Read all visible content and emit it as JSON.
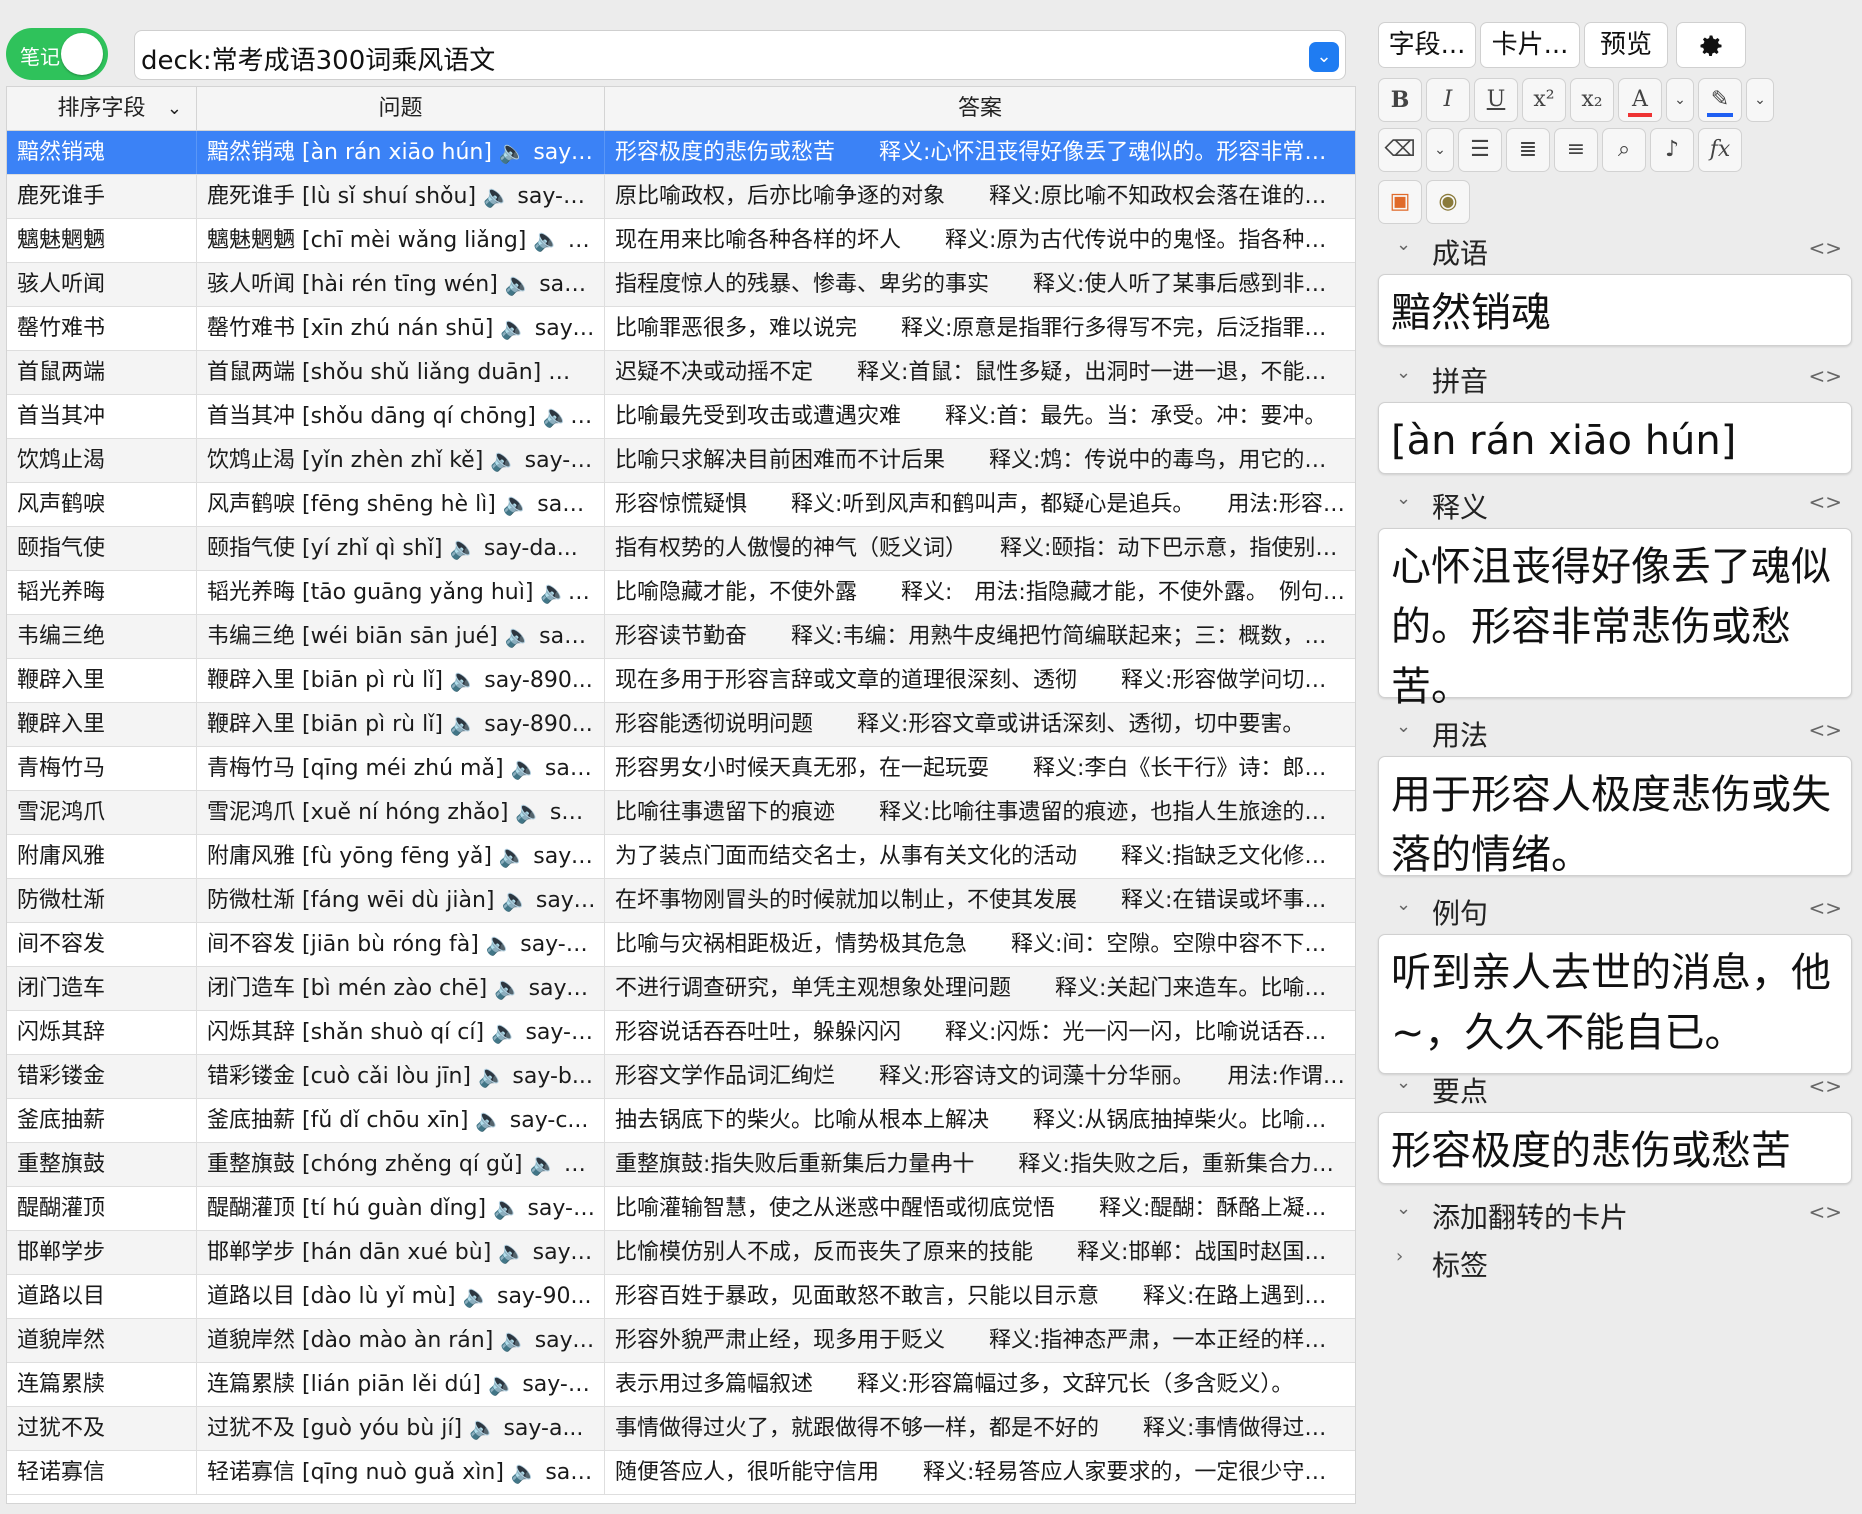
{
  "toolbar": {
    "toggle_label": "笔记",
    "search_value": "deck:常考成语300词乘风语文",
    "dropdown_icon": "chevron-down"
  },
  "table": {
    "columns": [
      {
        "label": "排序字段",
        "has_sort_caret": true
      },
      {
        "label": "问题"
      },
      {
        "label": "答案"
      }
    ],
    "selected_index": 0,
    "rows": [
      [
        "黯然销魂",
        "黯然销魂 [àn rán xiāo hún] 🔈 say-9...",
        "形容极度的悲伤或愁苦　　释义:心怀沮丧得好像丢了魂似的。形容非常悲伤或愁苦。"
      ],
      [
        "鹿死谁手",
        "鹿死谁手 [lù sǐ shuí shǒu] 🔈 say-9...",
        "原比喻政权，后亦比喻争逐的对象　　释义:原比喻不知政权会落在谁的手里。"
      ],
      [
        "魑魅魍魉",
        "魑魅魍魉 [chī mèi wǎng liǎng] 🔈 say...",
        "现在用来比喻各种各样的坏人　　释义:原为古代传说中的鬼怪。指各种各样的坏人。"
      ],
      [
        "骇人听闻",
        "骇人听闻 [hài rén tīng wén] 🔈 say-9...",
        "指程度惊人的残暴、惨毒、卑劣的事实　　释义:使人听了某事后感到非常震惊。"
      ],
      [
        "罄竹难书",
        "罄竹难书 [xīn zhú nán shū] 🔈 say-9...",
        "比喻罪恶很多，难以说完　　释义:原意是指罪行多得写不完，后泛指罪恶极多。"
      ],
      [
        "首鼠两端",
        "首鼠两端  [shǒu shǔ liǎng duān] 🔈 say...",
        "迟疑不决或动摇不定　　释义:首鼠：鼠性多疑，出洞时一进一退，不能自决。"
      ],
      [
        "首当其冲",
        "首当其冲 [shǒu dāng qí chōng] 🔈 say...",
        "比喻最先受到攻击或遭遇灾难　　释义:首：最先。当：承受。冲：要冲。"
      ],
      [
        "饮鸩止渴",
        "饮鸩止渴 [yǐn zhèn zhǐ kě] 🔈 say-9...",
        "比喻只求解决目前困难而不计后果　　释义:鸩：传说中的毒鸟，用它的羽毛泡酒。"
      ],
      [
        "风声鹤唳",
        "风声鹤唳 [fēng shēng hè lì] 🔈 say-9...",
        "形容惊慌疑惧　　释义:听到风声和鹤叫声，都疑心是追兵。　　用法:形容惊慌失措。"
      ],
      [
        "颐指气使",
        "颐指气使  [yí zhǐ qì shǐ] 🔈 say-da...",
        "指有权势的人傲慢的神气（贬义词）　　释义:颐指：动下巴示意，指使别人。"
      ],
      [
        "韬光养晦",
        "韬光养晦  [tāo guāng yǎng huì] 🔈 say...",
        "比喻隐藏才能，不使外露　　释义:　用法:指隐藏才能，不使外露。　例句:他"
      ],
      [
        "韦编三绝",
        "韦编三绝 [wéi biān sān jué] 🔈 say-9...",
        "形容读节勤奋　　释义:韦编：用熟牛皮绳把竹简编联起来；三：概数，表示多次。"
      ],
      [
        "鞭辟入里",
        "鞭辟入里 [biān pì rù lǐ] 🔈 say-890...",
        "现在多用于形容言辞或文章的道理很深刻、透彻　　释义:形容做学问切实。"
      ],
      [
        "鞭辟入里",
        "鞭辟入里 [biān pì rù lǐ] 🔈 say-890...",
        "形容能透彻说明问题　　释义:形容文章或讲话深刻、透彻，切中要害。"
      ],
      [
        "青梅竹马",
        "青梅竹马 [qīng méi zhú mǎ] 🔈 say-9...",
        "形容男女小时候天真无邪，在一起玩耍　　释义:李白《长干行》诗：郎骑竹马来。"
      ],
      [
        "雪泥鸿爪",
        "雪泥鸿爪 [xuě ní hóng zhǎo] 🔈 say-9...",
        "比喻往事遗留下的痕迹　　释义:比喻往事遗留的痕迹，也指人生旅途的经历。"
      ],
      [
        "附庸风雅",
        "附庸风雅 [fù yōng fēng yǎ] 🔈 say-9...",
        "为了装点门面而结交名士，从事有关文化的活动　　释义:指缺乏文化修养的人。"
      ],
      [
        "防微杜渐",
        "防微杜渐 [fáng wēi dù jiàn] 🔈 say-9...",
        "在坏事物刚冒头的时候就加以制止，不使其发展　　释义:在错误或坏事萌芽时。"
      ],
      [
        "间不容发",
        "间不容发 [jiān bù róng fà] 🔈 say-9...",
        "比喻与灾祸相距极近，情势极其危急　　释义:间：空隙。空隙中容不下一根头发。"
      ],
      [
        "闭门造车",
        "闭门造车 [bì mén zào chē] 🔈 say-9...",
        "不进行调查研究，单凭主观想象处理问题　　释义:关起门来造车。比喻脱离实际。"
      ],
      [
        "闪烁其辞",
        "闪烁其辞 [shǎn shuò qí cí] 🔈 say-9...",
        "形容说话吞吞吐吐，躲躲闪闪　　释义:闪烁：光一闪一闪，比喻说话吞吞吐吐。"
      ],
      [
        "错彩镂金",
        "错彩镂金 [cuò cǎi lòu jīn] 🔈 say-b...",
        "形容文学作品词汇绚烂　　释义:形容诗文的词藻十分华丽。　　用法:作谓语、定语。"
      ],
      [
        "釜底抽薪",
        "釜底抽薪 [fǔ dǐ chōu xīn] 🔈 say-c...",
        "抽去锅底下的柴火。比喻从根本上解决　　释义:从锅底抽掉柴火。比喻从根本上解决问题。"
      ],
      [
        "重整旗鼓",
        "重整旗鼓 [chóng zhěng qí gǔ] 🔈 say...",
        "重整旗鼓:指失败后重新集后力量冉十　　释义:指失败之后，重新集合力量再干。"
      ],
      [
        "醍醐灌顶",
        "醍醐灌顶 [tí hú guàn dǐng] 🔈 say-9...",
        "比喻灌输智慧，使之从迷惑中醒悟或彻底觉悟　　释义:醍醐：酥酪上凝聚的油。"
      ],
      [
        "邯郸学步",
        "邯郸学步 [hán dān xué bù] 🔈 say-9...",
        "比愉模仿别人不成，反而丧失了原来的技能　　释义:邯郸：战国时赵国的都城。"
      ],
      [
        "道路以目",
        "道路以目 [dào lù yǐ mù] 🔈 say-90...",
        "形容百姓于暴政，见面敢怒不敢言，只能以目示意　　释义:在路上遇到不敢交谈。"
      ],
      [
        "道貌岸然",
        "道貌岸然 [dào mào àn rán] 🔈 say-9...",
        "形容外貌严肃止经，现多用于贬义　　释义:指神态严肃，一本正经的样子。"
      ],
      [
        "连篇累牍",
        "连篇累牍 [lián piān lěi dú] 🔈 say-9...",
        "表示用过多篇幅叙述　　释义:形容篇幅过多，文辞冗长（多含贬义）。"
      ],
      [
        "过犹不及",
        "过犹不及 [guò yóu bù jí] 🔈 say-a...",
        "事情做得过火了，就跟做得不够一样，都是不好的　　释义:事情做得过头。"
      ],
      [
        "轻诺寡信",
        "轻诺寡信 [qīng nuò guǎ xìn] 🔈 say-9...",
        "随便答应人，很听能守信用　　释义:轻易答应人家要求的，一定很少守信用。"
      ]
    ]
  },
  "editor": {
    "buttons": {
      "fields": "字段...",
      "cards": "卡片...",
      "preview": "预览",
      "settings_icon": "gear-icon"
    },
    "format": {
      "bold": "B",
      "italic": "I",
      "underline": "U",
      "superscript": "x²",
      "subscript": "x₂",
      "text_color": "A",
      "highlight_icon": "highlighter-icon",
      "eraser_icon": "eraser-icon",
      "bullet_list_icon": "bullet-list-icon",
      "numbered_list_icon": "numbered-list-icon",
      "align_icon": "align-icon",
      "attach_icon": "paperclip-icon",
      "record_icon": "microphone-icon",
      "math_label": "fx",
      "chevron": "⌄",
      "text_color_hex": "#e33333",
      "highlight_color_hex": "#1f5ff2"
    },
    "fields": [
      {
        "name": "成语",
        "value": "黯然销魂"
      },
      {
        "name": "拼音",
        "value": "[àn rán xiāo hún]"
      },
      {
        "name": "释义",
        "value": "心怀沮丧得好像丢了魂似的。形容非常悲伤或愁苦。"
      },
      {
        "name": "用法",
        "value": "用于形容人极度悲伤或失落的情绪。"
      },
      {
        "name": "例句",
        "value": "听到亲人去世的消息，他~，久久不能自已。"
      },
      {
        "name": "要点",
        "value": "形容极度的悲伤或愁苦"
      },
      {
        "name": "添加翻转的卡片",
        "value": ""
      },
      {
        "name": "标签",
        "value": ""
      }
    ],
    "field_code_label": "<>"
  },
  "colors": {
    "accent": "#3b82f6",
    "toggle_on": "#2fc25b",
    "dropdown_blue": "#1f7cf2"
  }
}
